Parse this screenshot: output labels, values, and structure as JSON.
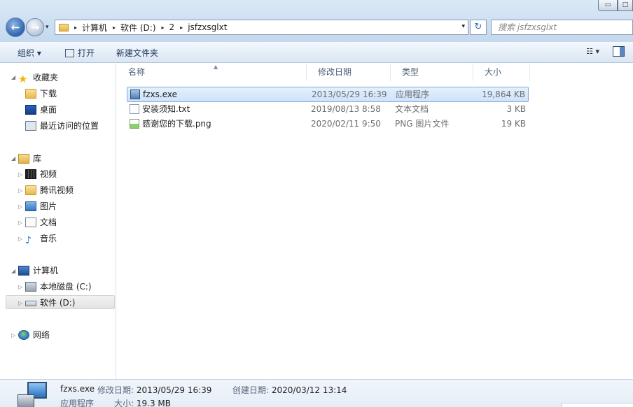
{
  "window": {
    "min_glyph": "▭",
    "max_glyph": "□"
  },
  "nav": {
    "back_glyph": "←",
    "forward_glyph": "→",
    "dropdown_glyph": "▾"
  },
  "address": {
    "separator": "▸",
    "crumbs": [
      "计算机",
      "软件 (D:)",
      "2",
      "jsfzxsglxt"
    ],
    "dropdown_glyph": "▾",
    "refresh_glyph": "↻"
  },
  "search": {
    "placeholder": "搜索 jsfzxsglxt"
  },
  "toolbar": {
    "organize_label": "组织 ▾",
    "open_label": "打开",
    "new_folder_label": "新建文件夹",
    "view_label": "☷ ▾"
  },
  "navpane": {
    "favorites": "收藏夹",
    "downloads": "下载",
    "desktop": "桌面",
    "recent": "最近访问的位置",
    "libraries": "库",
    "videos": "视频",
    "tencent_video": "腾讯视频",
    "pictures": "图片",
    "documents": "文档",
    "music": "音乐",
    "computer": "计算机",
    "local_disk_c": "本地磁盘 (C:)",
    "software_d": "软件 (D:)",
    "network": "网络",
    "expanded_glyph": "◢",
    "collapsed_glyph": "▷",
    "star_glyph": "★",
    "note_glyph": "♪"
  },
  "columns": {
    "name": "名称",
    "date_modified": "修改日期",
    "type": "类型",
    "size": "大小",
    "sort_glyph": "▲"
  },
  "files": [
    {
      "name": "fzxs.exe",
      "date": "2013/05/29 16:39",
      "type": "应用程序",
      "size": "19,864 KB"
    },
    {
      "name": "安装须知.txt",
      "date": "2019/08/13 8:58",
      "type": "文本文档",
      "size": "3 KB"
    },
    {
      "name": "感谢您的下载.png",
      "date": "2020/02/11 9:50",
      "type": "PNG 图片文件",
      "size": "19 KB"
    }
  ],
  "details": {
    "filename": "fzxs.exe",
    "modified_label": "修改日期:",
    "modified_value": "2013/05/29 16:39",
    "created_label": "创建日期:",
    "created_value": "2020/03/12 13:14",
    "type_value": "应用程序",
    "size_label": "大小:",
    "size_value": "19.3 MB"
  }
}
